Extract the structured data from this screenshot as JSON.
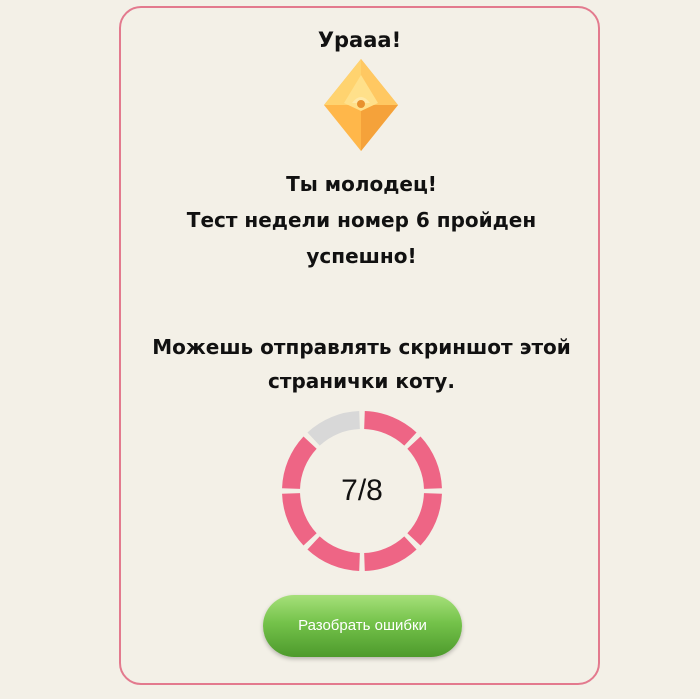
{
  "result": {
    "title": "Урааа!",
    "message_lines": [
      "Ты молодец!",
      "Тест недели номер 6 пройден",
      "успешно!"
    ],
    "hint_lines": [
      "Можешь отправлять скриншот этой",
      "странички коту."
    ]
  },
  "score": {
    "text": "7/8",
    "correct": 7,
    "total": 8,
    "color_correct": "#ee6585",
    "color_remaining": "#d8d8d8"
  },
  "actions": {
    "review_button_label": "Разобрать ошибки"
  },
  "icons": {
    "badge": "gem-icon"
  },
  "colors": {
    "background": "#f3f0e7",
    "card_border": "#e37a8e",
    "button": "#74c24a"
  }
}
